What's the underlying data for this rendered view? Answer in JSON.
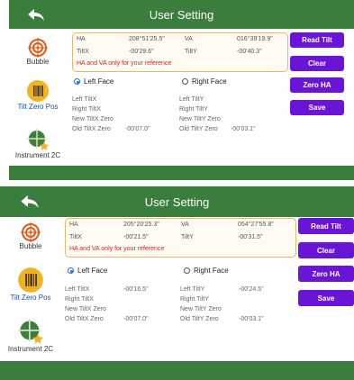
{
  "screen1": {
    "title": "User Setting",
    "sidebar": [
      "Bubble",
      "Tilt Zero Pos",
      "Instrument 2C"
    ],
    "readings": {
      "ha_label": "HA",
      "ha_value": "208°51'25.5\"",
      "va_label": "VA",
      "va_value": "016°39'19.9\"",
      "tiltx_label": "TiltX",
      "tiltx_value": "-00'29.6\"",
      "tilty_label": "TiltY",
      "tilty_value": "-00'40.3\"",
      "warning": "HA and VA only for your reference"
    },
    "face": {
      "left": "Left Face",
      "right": "Right Face",
      "selected": "left"
    },
    "rows": {
      "left_tiltx": "Left TiltX",
      "left_tiltx_value": "",
      "left_tilty": "Left TiltY",
      "left_tilty_value": "",
      "right_tiltx": "Right TiltX",
      "right_tilty": "Right TiltY",
      "new_tiltx_zero": "New TiltX Zero",
      "new_tilty_zero": "New TiltY Zero",
      "old_tiltx_zero": "Old TiltX Zero",
      "old_tiltx_zero_value": "-00'07.0\"",
      "old_tilty_zero": "Old TiltY Zero",
      "old_tilty_zero_value": "-00'03.1\""
    },
    "buttons": [
      "Read Tilt",
      "Clear",
      "Zero HA",
      "Save"
    ]
  },
  "screen2": {
    "title": "User Setting",
    "sidebar": [
      "Bubble",
      "Tilt Zero Pos",
      "Instrument 2C"
    ],
    "readings": {
      "ha_label": "HA",
      "ha_value": "205°20'25.3\"",
      "va_label": "VA",
      "va_value": "054°27'55.8\"",
      "tiltx_label": "TiltX",
      "tiltx_value": "-00'21.5\"",
      "tilty_label": "TiltY",
      "tilty_value": "-00'31.5\"",
      "warning": "HA and VA only for your reference"
    },
    "face": {
      "left": "Left Face",
      "right": "Right Face",
      "selected": "left"
    },
    "rows": {
      "left_tiltx": "Left TiltX",
      "left_tiltx_value": "-00'16.5\"",
      "left_tilty": "Left TiltY",
      "left_tilty_value": "-00'24.5\"",
      "right_tiltx": "Right TiltX",
      "right_tilty": "Right TiltY",
      "new_tiltx_zero": "New TiltX Zero",
      "new_tilty_zero": "New TiltY Zero",
      "old_tiltx_zero": "Old TiltX Zero",
      "old_tiltx_zero_value": "-00'07.0\"",
      "old_tilty_zero": "Old TiltY Zero",
      "old_tilty_zero_value": "-00'03.1\""
    },
    "buttons": [
      "Read Tilt",
      "Clear",
      "Zero HA",
      "Save"
    ]
  },
  "colors": {
    "header": "#3a7d3c",
    "button": "#6a14d8",
    "warning": "#dd2222",
    "radio": "#1e73d8"
  },
  "icons": {
    "back": "back-arrow-icon",
    "bubble": "target-icon",
    "tilt": "barcode-icon",
    "instrument": "crosshair-star-icon"
  }
}
